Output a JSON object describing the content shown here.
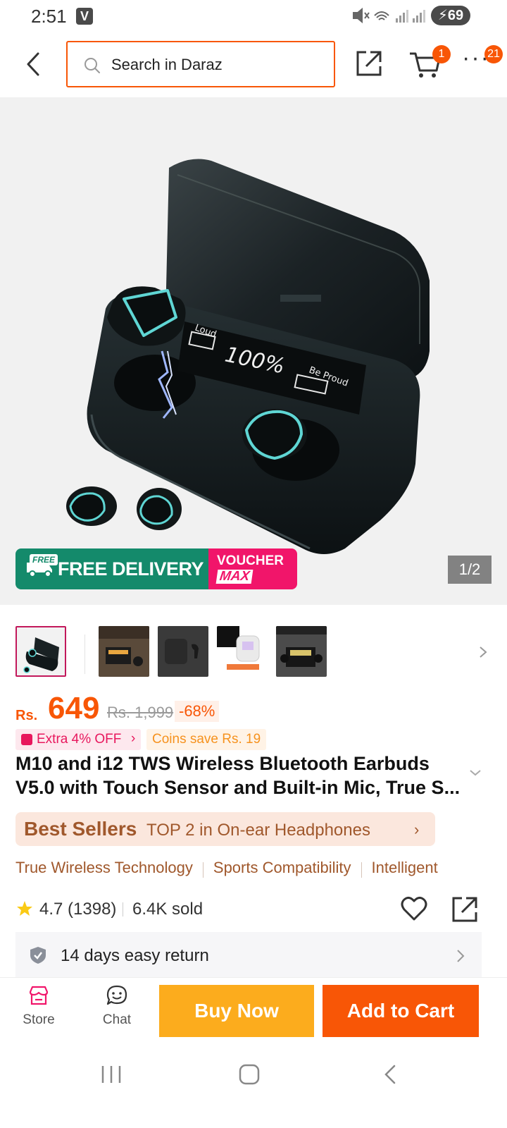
{
  "status_bar": {
    "time": "2:51",
    "app_badge": "V",
    "battery": "69"
  },
  "header": {
    "search_placeholder": "Search in Daraz",
    "cart_badge": "1",
    "more_badge": "21",
    "icons": [
      "back-arrow-icon",
      "search-icon",
      "share-icon",
      "cart-icon",
      "more-icon"
    ]
  },
  "gallery": {
    "counter": "1/2",
    "promo": {
      "free_tag": "FREE",
      "free_delivery": "FREE DELIVERY",
      "voucher": "VOUCHER",
      "max": "MAX"
    },
    "overlay_texts": {
      "loud": "Loud",
      "percent": "100%",
      "be_proud": "Be Proud"
    }
  },
  "thumbnails": {
    "count": 5,
    "selected_index": 0
  },
  "price": {
    "currency": "Rs.",
    "current": "649",
    "original": "Rs. 1,999",
    "discount": "-68%"
  },
  "chips": {
    "extra_off": "Extra 4% OFF",
    "coins": "Coins save Rs. 19"
  },
  "product": {
    "title": "M10 and i12 TWS Wireless Bluetooth Earbuds V5.0 with Touch Sensor and Built-in Mic, True S..."
  },
  "best_sellers": {
    "logo": "Best Sellers",
    "text": "TOP 2 in On-ear Headphones"
  },
  "tags": [
    "True Wireless Technology",
    "Sports Compatibility",
    "Intelligent"
  ],
  "rating": {
    "score": "4.7",
    "count": "(1398)",
    "sold": "6.4K sold"
  },
  "service": {
    "return_text": "14 days easy return"
  },
  "action_bar": {
    "store_label": "Store",
    "chat_label": "Chat",
    "buy_now": "Buy Now",
    "add_to_cart": "Add to Cart"
  },
  "colors": {
    "accent": "#f85606",
    "buy_now": "#fcac1d",
    "free_delivery": "#148a6b",
    "voucher": "#f1156a",
    "best_seller": "#a0582c"
  }
}
